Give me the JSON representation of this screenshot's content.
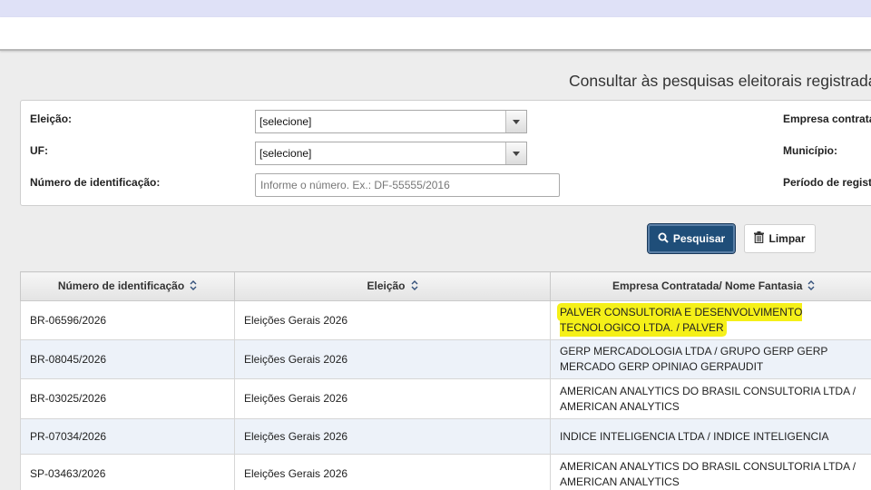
{
  "page": {
    "title": "Consultar às pesquisas eleitorais registradas"
  },
  "filters": {
    "eleicao": {
      "label": "Eleição:",
      "value": "[selecione]"
    },
    "uf": {
      "label": "UF:",
      "value": "[selecione]"
    },
    "numero": {
      "label": "Número de identificação:",
      "placeholder": "Informe o número. Ex.: DF-55555/2016"
    },
    "empresa": {
      "label": "Empresa contratada"
    },
    "municipio": {
      "label": "Município:"
    },
    "periodo": {
      "label": "Período de registro"
    }
  },
  "actions": {
    "search_label": "Pesquisar",
    "clear_label": "Limpar"
  },
  "table": {
    "columns": [
      "Número de identificação",
      "Eleição",
      "Empresa Contratada/ Nome Fantasia"
    ],
    "rows": [
      {
        "numero": "BR-06596/2026",
        "eleicao": "Eleições Gerais 2026",
        "empresa": "PALVER CONSULTORIA E DESENVOLVIMENTO TECNOLOGICO LTDA. / PALVER",
        "highlighted": true
      },
      {
        "numero": "BR-08045/2026",
        "eleicao": "Eleições Gerais 2026",
        "empresa": "GERP MERCADOLOGIA LTDA / GRUPO GERP GERP MERCADO GERP OPINIAO GERPAUDIT"
      },
      {
        "numero": "BR-03025/2026",
        "eleicao": "Eleições Gerais 2026",
        "empresa": "AMERICAN ANALYTICS DO BRASIL CONSULTORIA LTDA / AMERICAN ANALYTICS"
      },
      {
        "numero": "PR-07034/2026",
        "eleicao": "Eleições Gerais 2026",
        "empresa": "INDICE INTELIGENCIA LTDA / INDICE INTELIGENCIA"
      },
      {
        "numero": "SP-03463/2026",
        "eleicao": "Eleições Gerais 2026",
        "empresa": "AMERICAN ANALYTICS DO BRASIL CONSULTORIA LTDA / AMERICAN ANALYTICS"
      }
    ]
  },
  "colors": {
    "primary_button": "#1f4e79",
    "highlight": "#f5f018",
    "row_alt": "#edf2f9",
    "top_band": "#dfe1f7"
  },
  "icons": {
    "search": "search-icon",
    "clear": "trash-icon",
    "sort": "sort-icon",
    "dropdown": "chevron-down-icon"
  }
}
